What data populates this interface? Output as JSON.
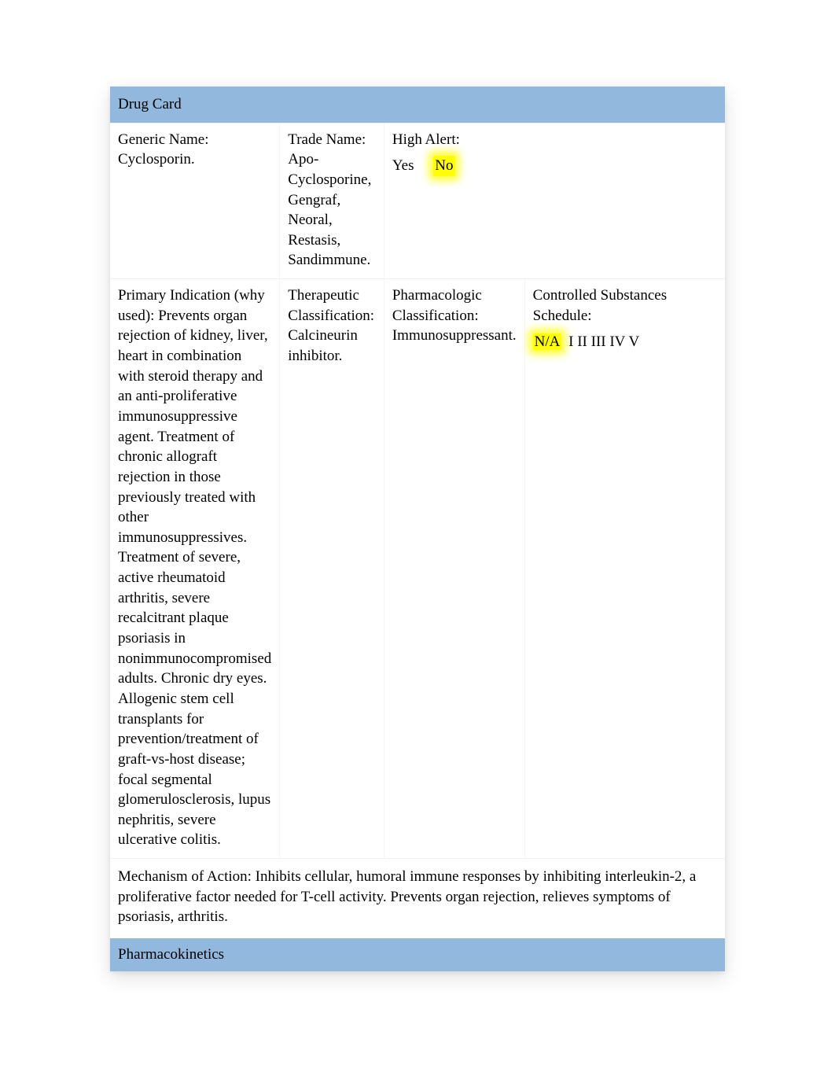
{
  "header": {
    "title": "Drug Card"
  },
  "row1": {
    "generic": {
      "label": "Generic Name:",
      "value": "Cyclosporin."
    },
    "trade": {
      "label": "Trade Name:",
      "value": "Apo-Cyclosporine, Gengraf, Neoral, Restasis, Sandimmune."
    },
    "highAlert": {
      "label": "High Alert:",
      "yes": "Yes",
      "no": "No"
    }
  },
  "row2": {
    "primaryIndication": {
      "label": "Primary Indication (why used):",
      "value": " Prevents organ rejection of kidney, liver, heart in combination with steroid therapy and an anti-proliferative immunosuppressive agent. Treatment of chronic allograft rejection in those previously treated with other immunosuppressives. Treatment of severe, active rheumatoid arthritis, severe recalcitrant plaque psoriasis in nonimmunocompromised adults. Chronic dry eyes. Allogenic stem cell transplants for prevention/treatment of graft-vs-host disease; focal segmental glomerulosclerosis, lupus nephritis, severe ulcerative colitis."
    },
    "therapeutic": {
      "label": "Therapeutic Classification:",
      "value": " Calcineurin inhibitor."
    },
    "pharmacologic": {
      "label": "Pharmacologic Classification:",
      "value": " Immunosuppressant."
    },
    "controlled": {
      "label": "Controlled Substances Schedule:",
      "na": "N/A",
      "rest": " I II III IV V"
    }
  },
  "row3": {
    "mechanism": {
      "label": "Mechanism of Action:",
      "value": " Inhibits cellular, humoral immune responses by inhibiting interleukin-2, a proliferative factor needed for T-cell activity. Prevents organ rejection, relieves symptoms of psoriasis, arthritis."
    }
  },
  "section2": {
    "title": "Pharmacokinetics"
  }
}
